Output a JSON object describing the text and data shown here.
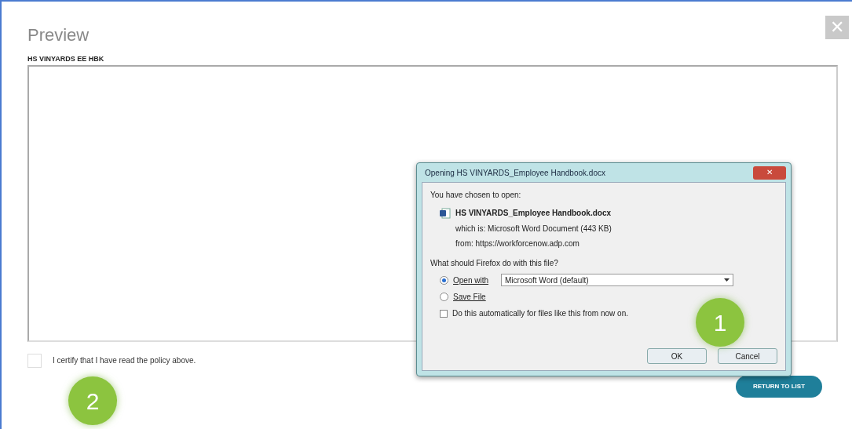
{
  "modal": {
    "title": "Preview",
    "close_label": "✕",
    "document_title": "HS VINYARDS EE HBK",
    "certify": {
      "label": "I certify that I have read the policy above.",
      "checked": false
    },
    "return_button": "RETURN TO LIST"
  },
  "download_dialog": {
    "title": "Opening HS VINYARDS_Employee Handbook.docx",
    "close_label": "✕",
    "intro": "You have chosen to open:",
    "file_name": "HS VINYARDS_Employee Handbook.docx",
    "file_type": "which is: Microsoft Word Document (443 KB)",
    "source": "from: https://workforcenow.adp.com",
    "question": "What should Firefox do with this file?",
    "options": [
      {
        "kind": "open",
        "label": "Open with",
        "selected": true,
        "app": "Microsoft Word (default)"
      },
      {
        "kind": "save",
        "label": "Save File",
        "selected": false
      }
    ],
    "auto": {
      "label": "Do this automatically for files like this from now on.",
      "checked": false
    },
    "buttons": [
      "OK",
      "Cancel"
    ]
  },
  "callouts": [
    "1",
    "2"
  ]
}
